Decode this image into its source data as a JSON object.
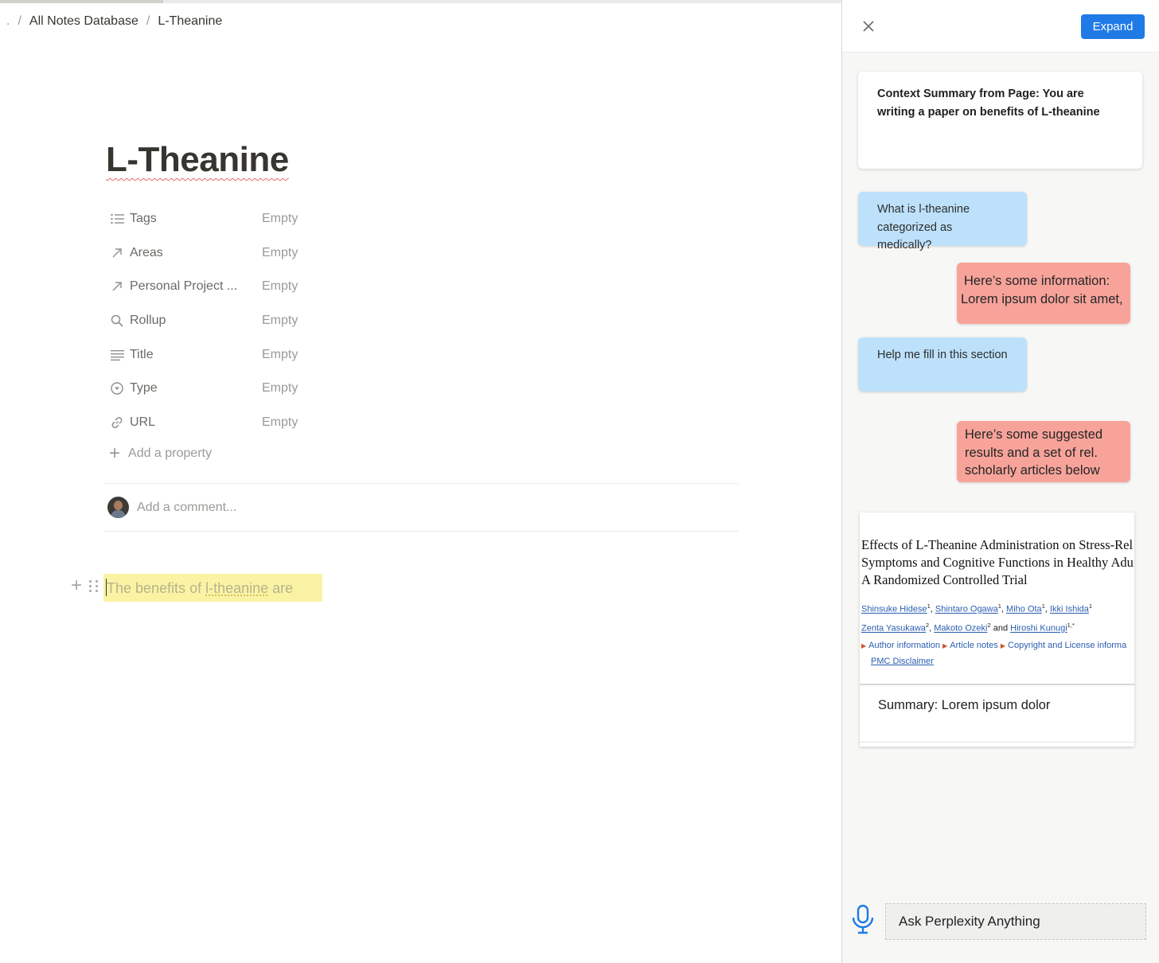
{
  "breadcrumb": {
    "lead": ".",
    "items": [
      "All Notes Database",
      "L-Theanine"
    ],
    "separator": "/"
  },
  "page": {
    "title": "L-Theanine",
    "properties": [
      {
        "icon": "list-icon",
        "label": "Tags",
        "value": "Empty"
      },
      {
        "icon": "arrow-up-right-icon",
        "label": "Areas",
        "value": "Empty"
      },
      {
        "icon": "arrow-up-right-icon",
        "label": "Personal Project ...",
        "value": "Empty"
      },
      {
        "icon": "search-icon",
        "label": "Rollup",
        "value": "Empty"
      },
      {
        "icon": "text-lines-icon",
        "label": "Title",
        "value": "Empty"
      },
      {
        "icon": "select-icon",
        "label": "Type",
        "value": "Empty"
      },
      {
        "icon": "link-icon",
        "label": "URL",
        "value": "Empty"
      }
    ],
    "add_property": "Add a property",
    "comment_placeholder": "Add a comment...",
    "block_text_before": "The benefits of ",
    "block_text_highlight": "l-theanine",
    "block_text_after": " are"
  },
  "panel": {
    "expand_label": "Expand",
    "context_summary": "Context Summary from Page: You are writing a paper on benefits of  L-theanine",
    "messages": [
      {
        "role": "user",
        "text": "What is l-theanine categorized as medically?"
      },
      {
        "role": "assistant",
        "lines": [
          "Here’s some information:",
          "Lorem ipsum dolor sit amet,"
        ]
      },
      {
        "role": "user",
        "text": "Help me fill in this section"
      },
      {
        "role": "assistant",
        "lines": [
          "Here’s some suggested",
          "results and a set of rel.",
          "scholarly articles below"
        ]
      }
    ],
    "article": {
      "title_lines": [
        "Effects of L-Theanine Administration on Stress-Rel",
        "Symptoms and Cognitive Functions in Healthy Adu",
        "A Randomized Controlled Trial"
      ],
      "authors": [
        {
          "name": "Shinsuke Hidese",
          "sup": "1"
        },
        {
          "name": "Shintaro Ogawa",
          "sup": "1"
        },
        {
          "name": "Miho Ota",
          "sup": "1"
        },
        {
          "name": "Ikki Ishida",
          "sup": "1"
        },
        {
          "name": "Zenta Yasukawa",
          "sup": "2"
        },
        {
          "name": "Makoto Ozeki",
          "sup": "2"
        },
        {
          "name": "Hiroshi Kunugi",
          "sup": "1,*"
        }
      ],
      "and_word": "and",
      "links": [
        "Author information",
        "Article notes",
        "Copyright and License informa"
      ],
      "disclaimer": "PMC Disclaimer",
      "summary": "Summary: Lorem ipsum dolor"
    },
    "ask_placeholder": "Ask Perplexity Anything"
  },
  "colors": {
    "accent": "#1f7ae6",
    "user_bubble": "#bde1fb",
    "assistant_bubble": "#f7a39a",
    "highlight": "#fbf3a4"
  }
}
